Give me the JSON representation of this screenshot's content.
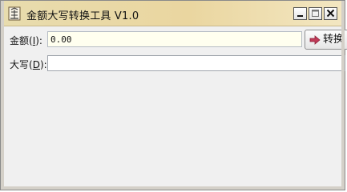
{
  "window": {
    "title": "金额大写转换工具 V1.0"
  },
  "titlebar_buttons": {
    "minimize": "minimize",
    "maximize": "maximize",
    "close": "close"
  },
  "form": {
    "amount_label": "金额",
    "amount_accel": "I",
    "amount_value": "0.00",
    "convert_label": "转换",
    "upper_label": "大写",
    "upper_accel": "D",
    "upper_value": ""
  }
}
